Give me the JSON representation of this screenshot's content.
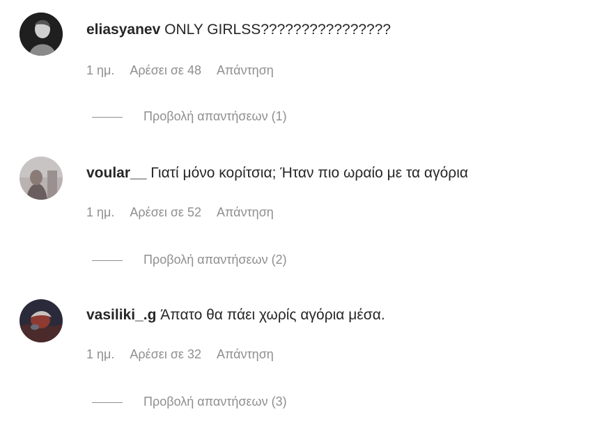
{
  "comments": [
    {
      "username": "eliasyanev",
      "text": "ONLY GIRLSS????????????????",
      "time": "1 ημ.",
      "likes": "Αρέσει σε 48",
      "reply": "Απάντηση",
      "view_replies": "Προβολή απαντήσεων (1)"
    },
    {
      "username": "voular__",
      "text": "Γιατί μόνο κορίτσια; Ήταν πιο ωραίο με τα αγόρια",
      "time": "1 ημ.",
      "likes": "Αρέσει σε 52",
      "reply": "Απάντηση",
      "view_replies": "Προβολή απαντήσεων (2)"
    },
    {
      "username": "vasiliki_.g",
      "text": "Άπατο θα πάει χωρίς αγόρια μέσα.",
      "time": "1 ημ.",
      "likes": "Αρέσει σε 32",
      "reply": "Απάντηση",
      "view_replies": "Προβολή απαντήσεων (3)"
    }
  ]
}
